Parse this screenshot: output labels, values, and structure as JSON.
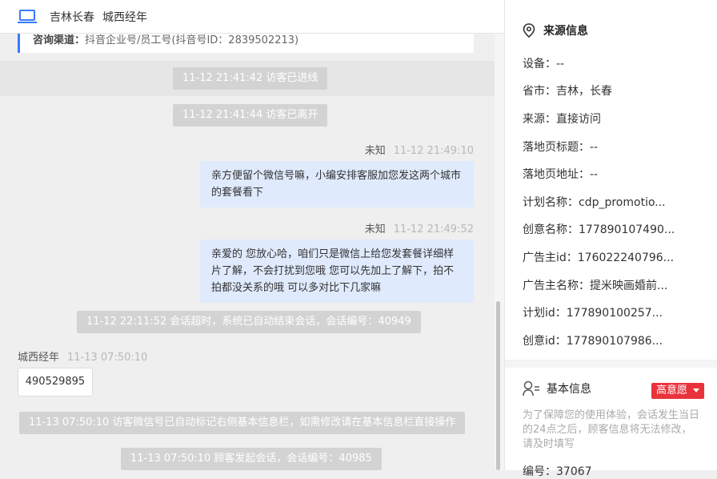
{
  "header": {
    "location": "吉林长春",
    "visitor_name": "城西经年"
  },
  "chat": {
    "top_card": {
      "label": "咨询渠道：",
      "value": "抖音企业号/员工号(抖音号ID：2839502213)"
    },
    "system_1": "11-12 21:41:42 访客已进线",
    "system_2": "11-12 21:41:44 访客已离开",
    "msg_1": {
      "sender": "未知",
      "time": "11-12 21:49:10",
      "text": "亲方便留个微信号嘛，小编安排客服加您发这两个城市的套餐看下"
    },
    "msg_2": {
      "sender": "未知",
      "time": "11-12 21:49:52",
      "text": "亲爱的 您放心哈，咱们只是微信上给您发套餐详细样片了解，不会打扰到您哦 您可以先加上了解下，拍不拍都没关系的哦 可以多对比下几家嘛"
    },
    "system_3": "11-12 22:11:52 会话超时，系统已自动结束会话，会话编号：40949",
    "msg_3": {
      "sender": "城西经年",
      "time": "11-13 07:50:10",
      "text": "490529895"
    },
    "system_4": "11-13 07:50:10 访客微信号已自动标记右侧基本信息栏，如需修改请在基本信息栏直接操作",
    "system_5": "11-13 07:50:10 顾客发起会话，会话编号：40985"
  },
  "source": {
    "title": "来源信息",
    "rows": [
      "设备：--",
      "省市：吉林，长春",
      "来源：直接访问",
      "落地页标题：--",
      "落地页地址：--",
      "计划名称：cdp_promotio...",
      "创意名称：177890107490...",
      "广告主id：176022240796...",
      "广告主名称：提米映画婚前...",
      "计划id：177890100257...",
      "创意id：177890107986..."
    ]
  },
  "basic": {
    "title": "基本信息",
    "badge": "高意愿",
    "note": "为了保障您的使用体验，会话发生当日的24点之后，顾客信息将无法修改，请及时填写",
    "partial_row": "编号：37067"
  },
  "colors": {
    "accent": "#3a7afe",
    "bubble": "#dfeafd",
    "badge": "#e8333c",
    "pill": "#d3d3d3"
  },
  "icons": [
    "laptop-icon",
    "location-pin-icon",
    "user-info-icon",
    "caret-down-icon"
  ]
}
